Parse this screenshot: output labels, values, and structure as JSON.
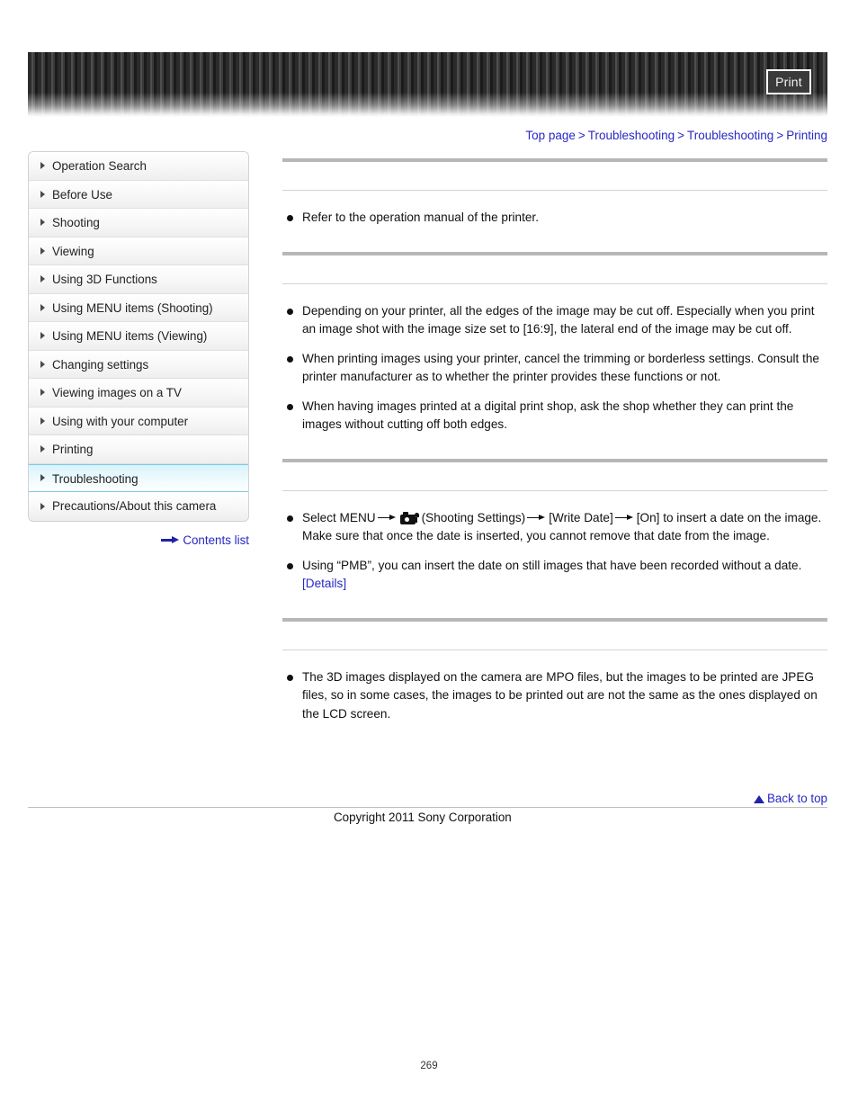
{
  "header": {
    "print_label": "Print"
  },
  "breadcrumb": {
    "items": [
      "Top page",
      "Troubleshooting",
      "Troubleshooting",
      "Printing"
    ],
    "separator": ">"
  },
  "sidebar": {
    "items": [
      {
        "label": "Operation Search",
        "active": false
      },
      {
        "label": "Before Use",
        "active": false
      },
      {
        "label": "Shooting",
        "active": false
      },
      {
        "label": "Viewing",
        "active": false
      },
      {
        "label": "Using 3D Functions",
        "active": false
      },
      {
        "label": "Using MENU items (Shooting)",
        "active": false
      },
      {
        "label": "Using MENU items (Viewing)",
        "active": false
      },
      {
        "label": "Changing settings",
        "active": false
      },
      {
        "label": "Viewing images on a TV",
        "active": false
      },
      {
        "label": "Using with your computer",
        "active": false
      },
      {
        "label": "Printing",
        "active": false
      },
      {
        "label": "Troubleshooting",
        "active": true
      },
      {
        "label": "Precautions/About this camera",
        "active": false
      }
    ],
    "contents_list_label": "Contents list"
  },
  "main": {
    "sections": [
      {
        "heading": "",
        "bullets": [
          {
            "text": "Refer to the operation manual of the printer."
          }
        ]
      },
      {
        "heading": "",
        "bullets": [
          {
            "text": "Depending on your printer, all the edges of the image may be cut off. Especially when you print an image shot with the image size set to [16:9], the lateral end of the image may be cut off."
          },
          {
            "text": "When printing images using your printer, cancel the trimming or borderless settings. Consult the printer manufacturer as to whether the printer provides these functions or not."
          },
          {
            "text": "When having images printed at a digital print shop, ask the shop whether they can print the images without cutting off both edges."
          }
        ]
      },
      {
        "heading": "",
        "bullets": [
          {
            "prefix": "Select MENU",
            "menu_label": "(Shooting Settings)",
            "step2": "[Write Date]",
            "step3": "[On] to insert a date on the image. Make sure that once the date is inserted, you cannot remove that date from the image."
          },
          {
            "text": "Using “PMB”, you can insert the date on still images that have been recorded without a date.",
            "link": "[Details]"
          }
        ]
      },
      {
        "heading": "",
        "bullets": [
          {
            "text": "The 3D images displayed on the camera are MPO files, but the images to be printed are JPEG files, so in some cases, the images to be printed out are not the same as the ones displayed on the LCD screen."
          }
        ]
      }
    ]
  },
  "footer": {
    "back_to_top_label": "Back to top",
    "copyright": "Copyright 2011 Sony Corporation",
    "page_number": "269"
  },
  "colors": {
    "link": "#2727c4",
    "active_sidebar": "#d9f3fb",
    "rule_thick": "#b7b7b7",
    "rule_thin": "#d3d3d3"
  }
}
